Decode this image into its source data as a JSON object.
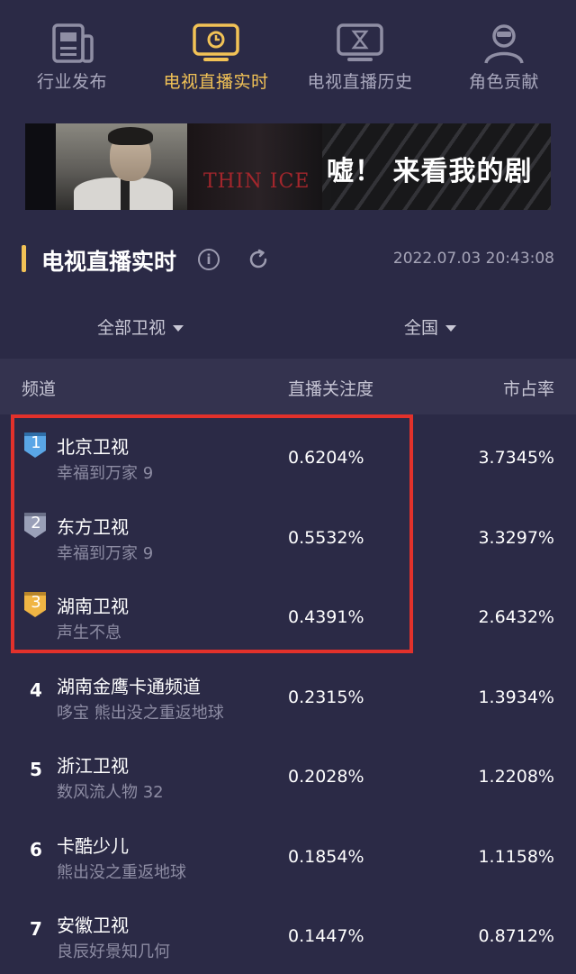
{
  "nav": {
    "items": [
      {
        "label": "行业发布",
        "icon": "newspaper-icon",
        "active": false
      },
      {
        "label": "电视直播实时",
        "icon": "tv-clock-icon",
        "active": true
      },
      {
        "label": "电视直播历史",
        "icon": "tv-hourglass-icon",
        "active": false
      },
      {
        "label": "角色贡献",
        "icon": "person-icon",
        "active": false
      }
    ],
    "active_color": "#f2c256",
    "inactive_color": "#a9a8bd"
  },
  "banner": {
    "english_title": "THIN ICE",
    "slogan": "嘘！ 来看我的剧"
  },
  "section": {
    "title": "电视直播实时",
    "info_icon": "info-icon",
    "info_glyph": "i",
    "refresh_icon": "refresh-icon",
    "timestamp": "2022.07.03 20:43:08"
  },
  "filters": {
    "channel_filter": "全部卫视",
    "region_filter": "全国"
  },
  "table": {
    "headers": {
      "channel": "频道",
      "attention": "直播关注度",
      "share": "市占率"
    },
    "rows": [
      {
        "rank": "1",
        "channel": "北京卫视",
        "program": "幸福到万家 9",
        "attention": "0.6204%",
        "share": "3.7345%",
        "badge_color": "#5aa6e6"
      },
      {
        "rank": "2",
        "channel": "东方卫视",
        "program": "幸福到万家 9",
        "attention": "0.5532%",
        "share": "3.3297%",
        "badge_color": "#9aa0b8"
      },
      {
        "rank": "3",
        "channel": "湖南卫视",
        "program": "声生不息",
        "attention": "0.4391%",
        "share": "2.6432%",
        "badge_color": "#f0b544"
      },
      {
        "rank": "4",
        "channel": "湖南金鹰卡通频道",
        "program": "哆宝 熊出没之重返地球",
        "attention": "0.2315%",
        "share": "1.3934%"
      },
      {
        "rank": "5",
        "channel": "浙江卫视",
        "program": "数风流人物 32",
        "attention": "0.2028%",
        "share": "1.2208%"
      },
      {
        "rank": "6",
        "channel": "卡酷少儿",
        "program": "熊出没之重返地球",
        "attention": "0.1854%",
        "share": "1.1158%"
      },
      {
        "rank": "7",
        "channel": "安徽卫视",
        "program": "良辰好景知几何",
        "attention": "0.1447%",
        "share": "0.8712%"
      }
    ]
  },
  "highlight_color": "#e2312b"
}
